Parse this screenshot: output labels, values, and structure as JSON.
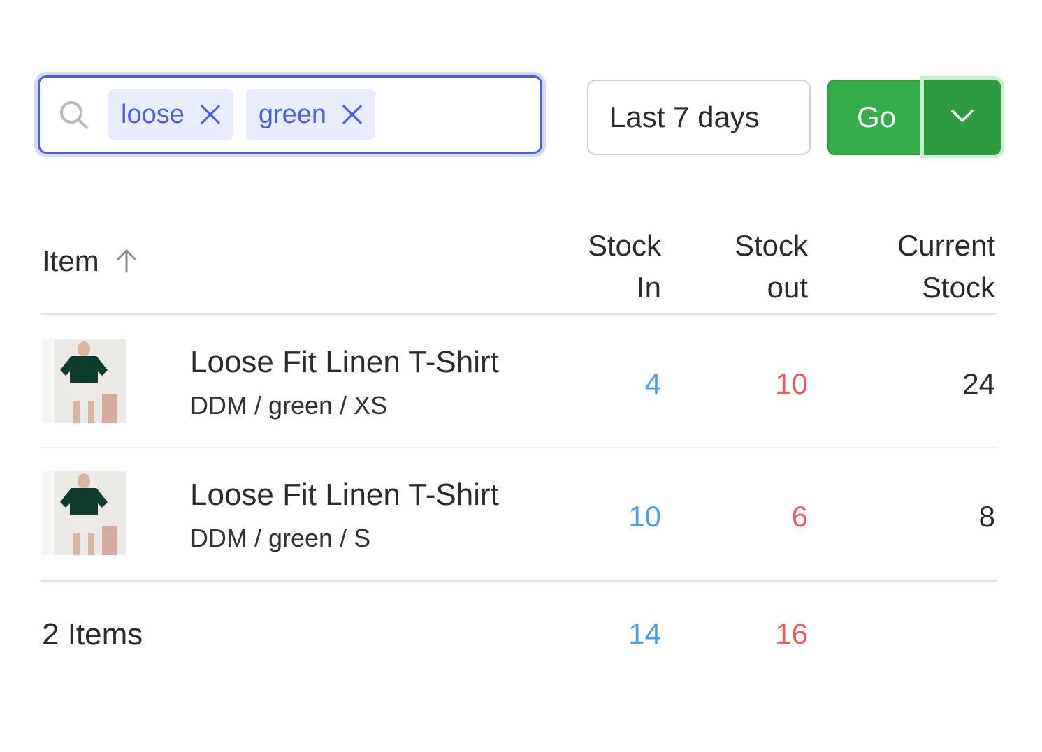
{
  "filters": {
    "tags": [
      {
        "label": "loose"
      },
      {
        "label": "green"
      }
    ],
    "date_range": "Last 7 days",
    "go_label": "Go"
  },
  "table": {
    "columns": {
      "item": "Item",
      "stock_in_1": "Stock",
      "stock_in_2": "In",
      "stock_out_1": "Stock",
      "stock_out_2": "out",
      "current_1": "Current",
      "current_2": "Stock"
    },
    "rows": [
      {
        "name": "Loose Fit Linen T-Shirt",
        "variant": "DDM / green / XS",
        "stock_in": "4",
        "stock_out": "10",
        "current": "24"
      },
      {
        "name": "Loose Fit Linen T-Shirt",
        "variant": "DDM / green / S",
        "stock_in": "10",
        "stock_out": "6",
        "current": "8"
      }
    ],
    "footer": {
      "label": "2 Items",
      "stock_in_total": "14",
      "stock_out_total": "16"
    }
  },
  "colors": {
    "accent": "#4b5fe0",
    "go_green": "#35ad48",
    "stock_in": "#4a9ee8",
    "stock_out": "#ea5a60"
  }
}
